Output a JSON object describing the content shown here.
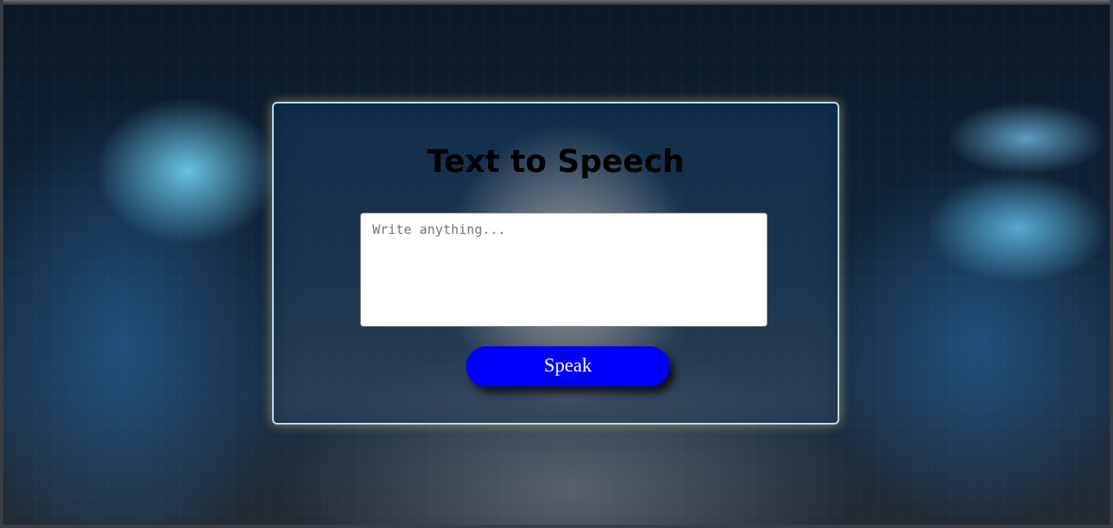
{
  "main": {
    "title": "Text to Speech",
    "input": {
      "placeholder": "Write anything...",
      "value": ""
    },
    "speak_label": "Speak"
  },
  "colors": {
    "button": "#0000ff",
    "button_text": "#ffffff",
    "card_border": "#bfe3f0",
    "title": "#000000"
  },
  "icons": {
    "background": "blurred-futuristic-tech-background-image"
  }
}
